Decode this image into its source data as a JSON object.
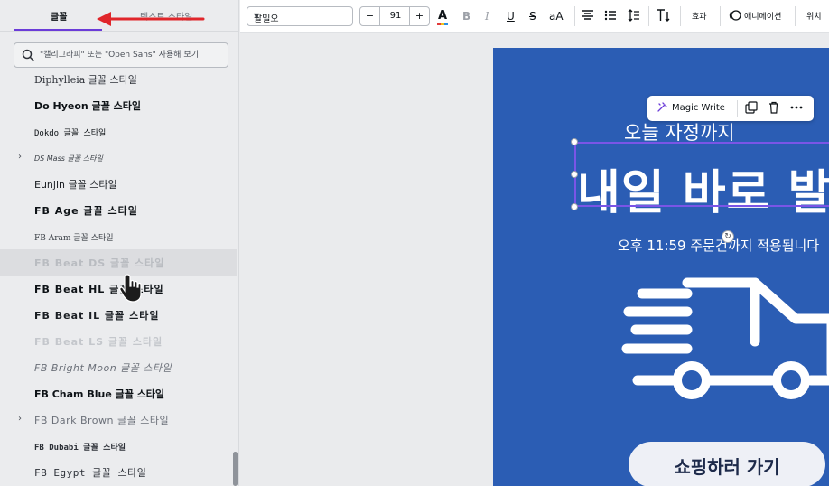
{
  "left_panel": {
    "tabs": [
      {
        "label": "글꼴"
      },
      {
        "label": "텍스트 스타일"
      }
    ],
    "search": {
      "placeholder": "\"캘리그라피\" 또는 \"Open Sans\" 사용해 보기"
    },
    "fonts": [
      {
        "name": "Diphylleia 글꼴 스타일",
        "expandable": false
      },
      {
        "name": "Do Hyeon 글꼴 스타일",
        "expandable": false
      },
      {
        "name": "Dokdo 글꼴 스타일",
        "expandable": false
      },
      {
        "name": "DS Mass 글꼴 스타일",
        "expandable": true
      },
      {
        "name": "Eunjin 글꼴 스타일",
        "expandable": false
      },
      {
        "name": "FB Age 글꼴 스타일",
        "expandable": false
      },
      {
        "name": "FB Aram 글꼴 스타일",
        "expandable": false
      },
      {
        "name": "FB Beat DS 글꼴 스타일",
        "expandable": false
      },
      {
        "name": "FB Beat HL 글꼴 스타일",
        "expandable": false
      },
      {
        "name": "FB Beat IL 글꼴 스타일",
        "expandable": false
      },
      {
        "name": "FB Beat LS 글꼴 스타일",
        "expandable": false
      },
      {
        "name": "FB Bright Moon 글꼴 스타일",
        "expandable": false
      },
      {
        "name": "FB Cham Blue 글꼴 스타일",
        "expandable": false
      },
      {
        "name": "FB Dark Brown 글꼴 스타일",
        "expandable": true
      },
      {
        "name": "FB Dubabi 글꼴 스타일",
        "expandable": false
      },
      {
        "name": "FB Egypt 글꼴 스타일",
        "expandable": false
      }
    ]
  },
  "toolbar": {
    "font_name": "팔밀오",
    "font_size": "91",
    "minus": "−",
    "plus": "+",
    "color_icon": "A",
    "bold": "B",
    "italic": "I",
    "underline": "U",
    "strike": "S",
    "case": "aA",
    "effects_label": "효과",
    "animate_label": "애니메이션",
    "position_label": "위치"
  },
  "canvas": {
    "line1": "오늘 자정까지",
    "headline": "내일 바로 발",
    "sub": "오후 11:59 주문건까지 적용됩니다",
    "shop_button": "쇼핑하러 가기",
    "float_toolbar": {
      "magic_write": "Magic Write"
    }
  },
  "colors": {
    "accent": "#6b3cd8",
    "design_bg": "#2b5db4",
    "arrow": "#e0262b"
  }
}
